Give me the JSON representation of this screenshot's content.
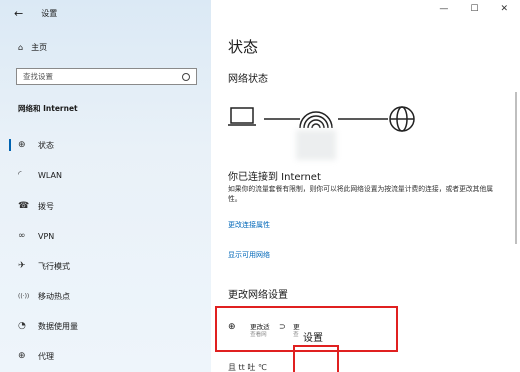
{
  "window": {
    "title": "设置",
    "back_glyph": "←",
    "minimize": "—",
    "maximize": "☐",
    "close": "✕"
  },
  "sidebar": {
    "home_label": "主页",
    "search_placeholder": "查找设置",
    "section_title": "网络和 Internet",
    "items": [
      {
        "label": "状态",
        "icon": "network-status-icon",
        "glyph": "⊕"
      },
      {
        "label": "WLAN",
        "icon": "wifi-icon",
        "glyph": "◜"
      },
      {
        "label": "拨号",
        "icon": "dialup-icon",
        "glyph": "☎"
      },
      {
        "label": "VPN",
        "icon": "vpn-icon",
        "glyph": "∞"
      },
      {
        "label": "飞行模式",
        "icon": "airplane-icon",
        "glyph": "✈"
      },
      {
        "label": "移动热点",
        "icon": "hotspot-icon",
        "glyph": "((·))"
      },
      {
        "label": "数据使用量",
        "icon": "data-usage-icon",
        "glyph": "◔"
      },
      {
        "label": "代理",
        "icon": "proxy-icon",
        "glyph": "⊕"
      }
    ]
  },
  "main": {
    "title": "状态",
    "network_status": "网络状态",
    "connected_text": "你已连接到 Internet",
    "description": "如果你的流量套餐有限制，则你可以将此网络设置为按流量计费的连接，或者更改其他属性。",
    "link_change_props": "更改连接属性",
    "link_show_networks": "显示可用网络",
    "change_settings_title": "更改网络设置",
    "option1_title": "更改适",
    "option1_sub": "查看网",
    "option2_title": "更",
    "option2_sub": "查",
    "overlay_setting_text": "设置",
    "bottom_partial": "且 tt 吐 ℃"
  }
}
